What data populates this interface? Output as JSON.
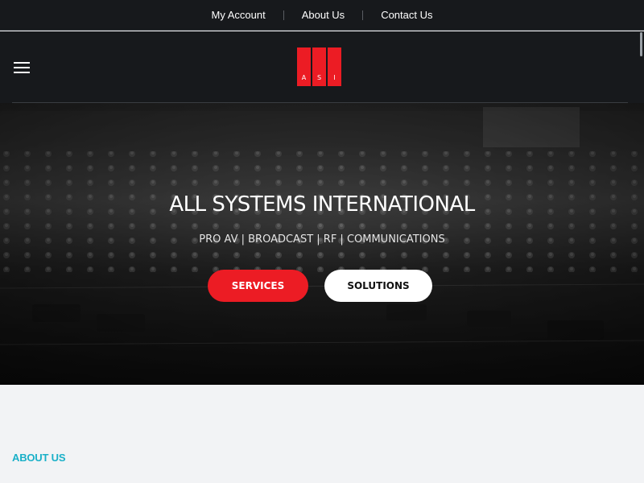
{
  "top_nav": {
    "links": [
      "My Account",
      "About Us",
      "Contact Us"
    ]
  },
  "header": {
    "menu_icon": "hamburger-menu-icon",
    "logo": {
      "letters": [
        "A",
        "S",
        "I"
      ],
      "color": "#ec1c24"
    }
  },
  "hero": {
    "title": "ALL SYSTEMS INTERNATIONAL",
    "subtitle": "PRO AV | BROADCAST | RF | COMMUNICATIONS",
    "buttons": {
      "services": "SERVICES",
      "solutions": "SOLUTIONS"
    }
  },
  "about": {
    "heading": "ABOUT US"
  },
  "colors": {
    "accent_red": "#ec1c24",
    "accent_teal": "#1ab0c8",
    "dark_bg": "#17191c"
  }
}
